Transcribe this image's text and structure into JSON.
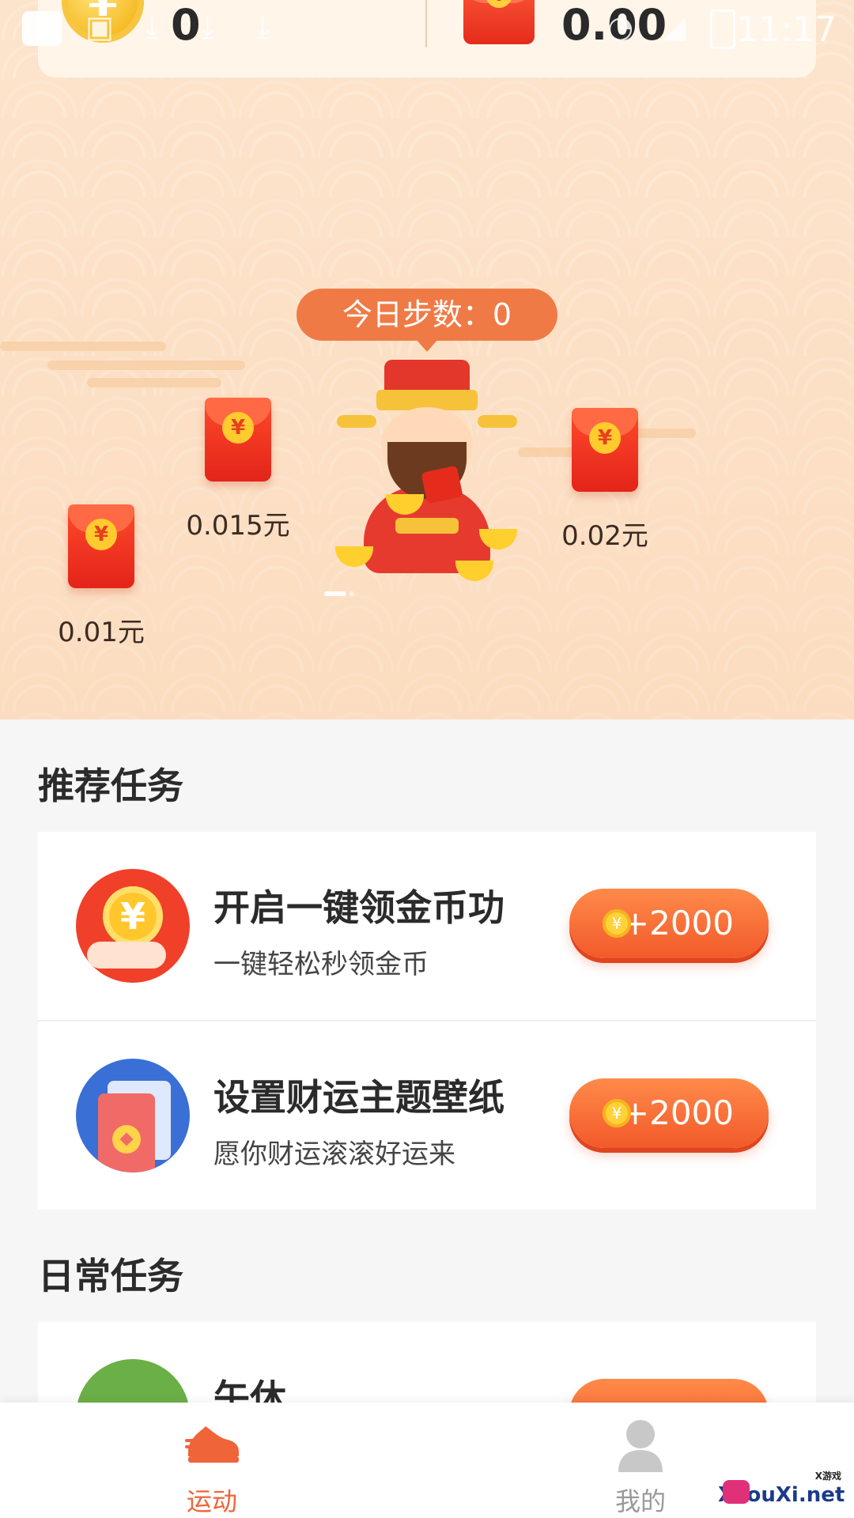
{
  "status_bar": {
    "time": "11:17"
  },
  "summary": {
    "coin_icon": "coin-icon",
    "coin_symbol": "¥",
    "coins": "0",
    "envelope_icon": "red-envelope-icon",
    "envelope_symbol": "¥",
    "cash": "0.00"
  },
  "hero": {
    "steps_label": "今日步数：0",
    "envelopes": [
      {
        "label": "0.01元",
        "symbol": "¥"
      },
      {
        "label": "0.015元",
        "symbol": "¥"
      },
      {
        "label": "0.02元",
        "symbol": "¥"
      }
    ]
  },
  "recommended": {
    "title": "推荐任务",
    "tasks": [
      {
        "title": "开启一键领金币功",
        "subtitle": "一键轻松秒领金币",
        "reward": "+2000",
        "icon": "coin-hand-icon",
        "icon_symbol": "¥"
      },
      {
        "title": "设置财运主题壁纸",
        "subtitle": "愿你财运滚滚好运来",
        "reward": "+2000",
        "icon": "wallpaper-icon"
      }
    ]
  },
  "daily": {
    "title": "日常任务",
    "tasks": [
      {
        "title": "午休",
        "icon": "nap-icon"
      }
    ]
  },
  "nav": {
    "items": [
      {
        "label": "运动",
        "icon": "sneaker-icon",
        "active": true
      },
      {
        "label": "我的",
        "icon": "profile-icon",
        "active": false
      }
    ]
  },
  "watermark": {
    "text": "XYouXi.net",
    "tag": "X游戏"
  },
  "colors": {
    "accent": "#f0643a",
    "inactive": "#999999",
    "hero_bg": "#fce1c7",
    "envelope_red": "#e3241a"
  }
}
